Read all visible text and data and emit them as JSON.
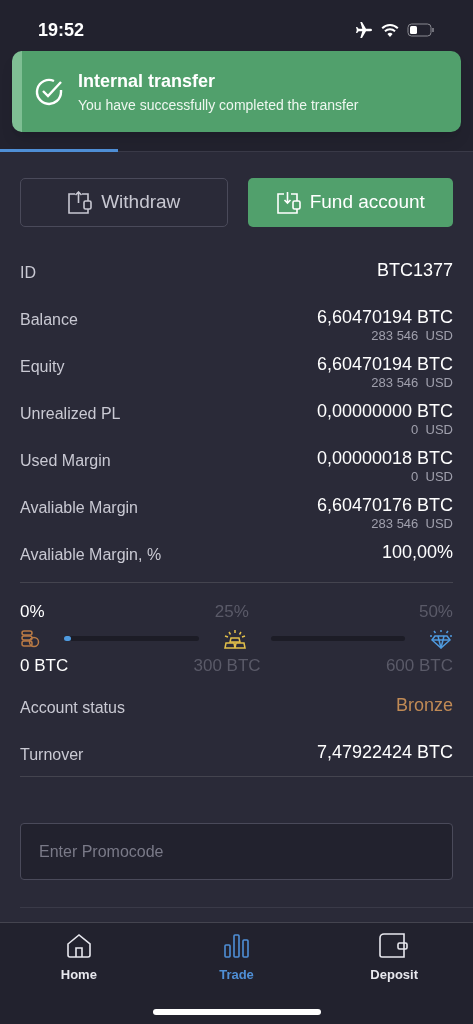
{
  "status_bar": {
    "time": "19:52"
  },
  "toast": {
    "title": "Internal transfer",
    "message": "You have successfully completed the transfer"
  },
  "tabs": [
    {
      "selected": true
    },
    {
      "selected": false
    },
    {
      "selected": false
    },
    {
      "selected": false
    }
  ],
  "actions": [
    {
      "label": "Withdraw",
      "kind": "outline"
    },
    {
      "label": "Fund account",
      "kind": "primary"
    }
  ],
  "rows": [
    {
      "label": "ID",
      "value": "BTC1377"
    },
    {
      "label": "Balance",
      "value": "6,60470194 BTC",
      "sub": "283 546  USD"
    },
    {
      "label": "Equity",
      "value": "6,60470194 BTC",
      "sub": "283 546  USD"
    },
    {
      "label": "Unrealized PL",
      "value": "0,00000000 BTC",
      "sub": "0  USD"
    },
    {
      "label": "Used Margin",
      "value": "0,00000018 BTC",
      "sub": "0  USD"
    },
    {
      "label": "Avaliable Margin",
      "value": "6,60470176 BTC",
      "sub": "283 546  USD"
    },
    {
      "label": "Avaliable Margin, %",
      "value": "100,00%"
    }
  ],
  "progress": {
    "milestones": [
      {
        "percent": "0%",
        "amount": "0 BTC",
        "reached": true,
        "color": "#b97a45"
      },
      {
        "percent": "25%",
        "amount": "300 BTC",
        "reached": false,
        "color": "#e2c04a"
      },
      {
        "percent": "50%",
        "amount": "600 BTC",
        "reached": false,
        "color": "#4f9be0"
      }
    ],
    "segments": [
      {
        "level": 0.05
      }
    ]
  },
  "status_rows": [
    {
      "label": "Account status",
      "value": "Bronze",
      "kind": "status"
    },
    {
      "label": "Turnover",
      "value": "7,47922424 BTC",
      "kind": "plain"
    }
  ],
  "promo": {
    "placeholder": "Enter Promocode"
  },
  "nav": [
    {
      "label": "Home",
      "selected": false
    },
    {
      "label": "Trade",
      "selected": true
    },
    {
      "label": "Deposit",
      "selected": false
    }
  ]
}
